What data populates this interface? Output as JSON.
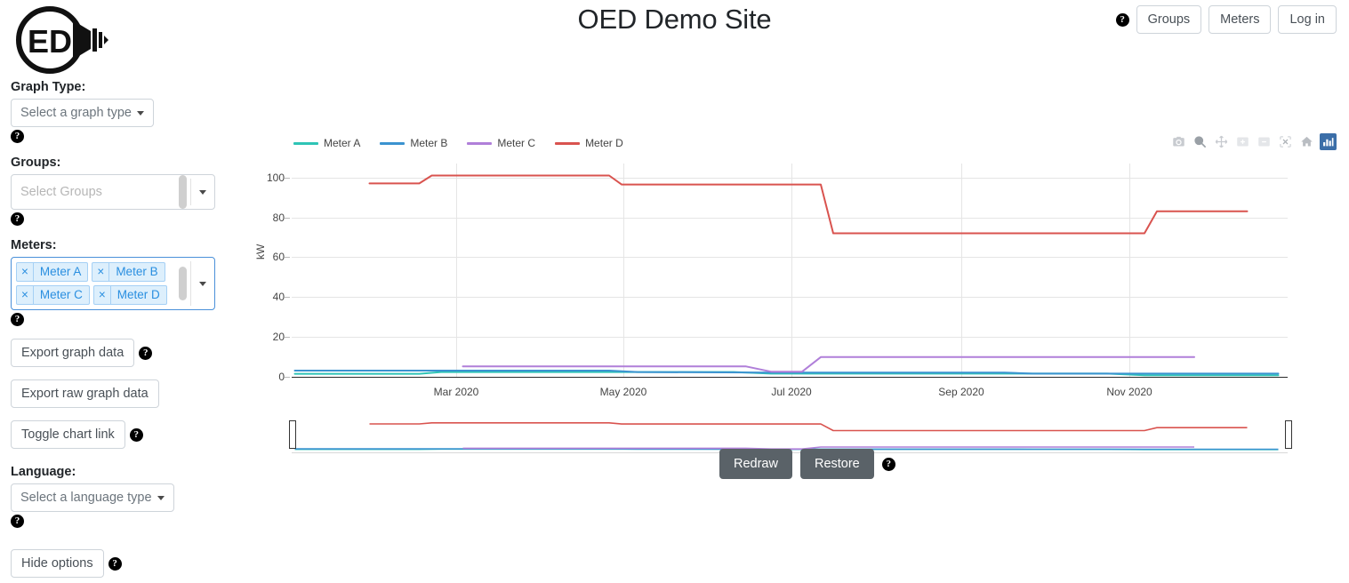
{
  "header": {
    "title": "OED Demo Site",
    "help_icon": "help-circle-icon",
    "buttons": [
      {
        "label": "Groups",
        "name": "groups-button"
      },
      {
        "label": "Meters",
        "name": "meters-button"
      },
      {
        "label": "Log in",
        "name": "login-button"
      }
    ],
    "logo_text": "ED"
  },
  "sidebar": {
    "graph_type": {
      "label": "Graph Type:",
      "placeholder": "Select a graph type"
    },
    "groups": {
      "label": "Groups:",
      "placeholder": "Select Groups"
    },
    "meters": {
      "label": "Meters:",
      "selected": [
        "Meter A",
        "Meter B",
        "Meter C",
        "Meter D"
      ],
      "remove_glyph": "×"
    },
    "export_graph": "Export graph data",
    "export_raw": "Export raw graph data",
    "toggle_chart_link": "Toggle chart link",
    "language": {
      "label": "Language:",
      "placeholder": "Select a language type"
    },
    "hide_options": "Hide options"
  },
  "chart_controls": {
    "redraw": "Redraw",
    "restore": "Restore"
  },
  "modebar": {
    "items": [
      {
        "name": "camera-icon",
        "title": "Download plot as a png",
        "active": false
      },
      {
        "name": "zoom-icon",
        "title": "Zoom",
        "active": false
      },
      {
        "name": "pan-icon",
        "title": "Pan",
        "active": false
      },
      {
        "name": "zoom-in-icon",
        "title": "Zoom in",
        "active": false
      },
      {
        "name": "zoom-out-icon",
        "title": "Zoom out",
        "active": false
      },
      {
        "name": "autoscale-icon",
        "title": "Autoscale",
        "active": false
      },
      {
        "name": "home-icon",
        "title": "Reset axes",
        "active": false
      },
      {
        "name": "plotly-logo-icon",
        "title": "Produced with Plotly",
        "active": true
      }
    ]
  },
  "chart_data": {
    "type": "line",
    "title": "",
    "xlabel": "",
    "ylabel": "kW",
    "ylim": [
      0,
      107
    ],
    "yticks": [
      0,
      20,
      40,
      60,
      80,
      100
    ],
    "xticks": [
      "Mar 2020",
      "May 2020",
      "Jul 2020",
      "Sep 2020",
      "Nov 2020"
    ],
    "xlim": [
      "2020-01-20",
      "2020-12-05"
    ],
    "grid": true,
    "legend_position": "top-left",
    "colors": {
      "Meter A": "#2ec4b6",
      "Meter B": "#3b93d0",
      "Meter C": "#b07fd9",
      "Meter D": "#d9534f"
    },
    "series": [
      {
        "name": "Meter A",
        "color": "#2ec4b6",
        "points": [
          {
            "x": "2020-01-21",
            "y": 1.5
          },
          {
            "x": "2020-03-01",
            "y": 1.5
          },
          {
            "x": "2020-03-08",
            "y": 2.4
          },
          {
            "x": "2020-06-10",
            "y": 2.4
          },
          {
            "x": "2020-06-22",
            "y": 1.6
          },
          {
            "x": "2020-10-08",
            "y": 1.6
          },
          {
            "x": "2020-10-20",
            "y": 0.8
          },
          {
            "x": "2020-12-02",
            "y": 0.8
          }
        ]
      },
      {
        "name": "Meter B",
        "color": "#3b93d0",
        "points": [
          {
            "x": "2020-01-21",
            "y": 3.1
          },
          {
            "x": "2020-05-01",
            "y": 3.1
          },
          {
            "x": "2020-05-10",
            "y": 2.4
          },
          {
            "x": "2020-06-22",
            "y": 2.1
          },
          {
            "x": "2020-09-05",
            "y": 2.1
          },
          {
            "x": "2020-09-14",
            "y": 1.6
          },
          {
            "x": "2020-12-02",
            "y": 1.6
          }
        ]
      },
      {
        "name": "Meter C",
        "color": "#b07fd9",
        "points": [
          {
            "x": "2020-03-15",
            "y": 5.2
          },
          {
            "x": "2020-06-14",
            "y": 5.2
          },
          {
            "x": "2020-06-22",
            "y": 2.6
          },
          {
            "x": "2020-07-02",
            "y": 2.6
          },
          {
            "x": "2020-07-08",
            "y": 9.9
          },
          {
            "x": "2020-11-05",
            "y": 9.9
          }
        ]
      },
      {
        "name": "Meter D",
        "color": "#d9534f",
        "points": [
          {
            "x": "2020-02-14",
            "y": 97
          },
          {
            "x": "2020-03-01",
            "y": 97
          },
          {
            "x": "2020-03-05",
            "y": 101
          },
          {
            "x": "2020-05-01",
            "y": 101
          },
          {
            "x": "2020-05-05",
            "y": 96.5
          },
          {
            "x": "2020-07-08",
            "y": 96.5
          },
          {
            "x": "2020-07-12",
            "y": 72
          },
          {
            "x": "2020-10-20",
            "y": 72
          },
          {
            "x": "2020-10-24",
            "y": 83
          },
          {
            "x": "2020-11-22",
            "y": 83
          }
        ]
      }
    ],
    "rangeslider": {
      "visible": true,
      "start_fraction": 0.0,
      "end_fraction": 1.0
    }
  }
}
